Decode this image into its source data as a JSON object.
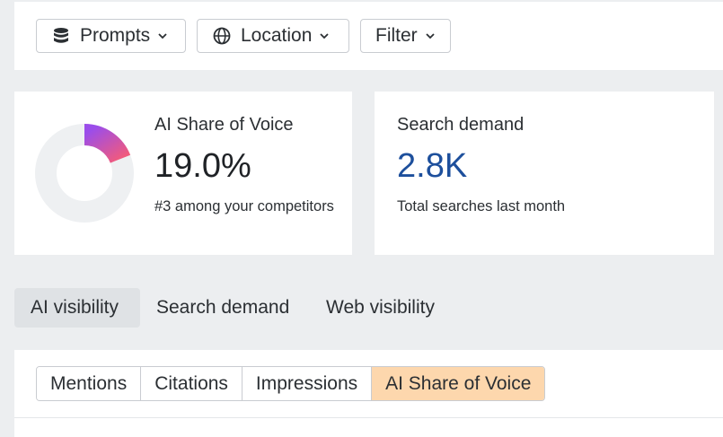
{
  "filters": {
    "prompts_label": "Prompts",
    "location_label": "Location",
    "filter_label": "Filter"
  },
  "share_of_voice": {
    "title": "AI Share of Voice",
    "value": "19.0%",
    "fraction": 0.19,
    "subtitle": "#3 among your competitors",
    "gradient_start": "#9b4dea",
    "gradient_end": "#f05a7e",
    "track_color": "#eef0f2"
  },
  "search_demand": {
    "title": "Search demand",
    "value": "2.8K",
    "subtitle": "Total searches last month",
    "value_color": "#1d4f9c"
  },
  "tabs": [
    {
      "label": "AI visibility",
      "active": true
    },
    {
      "label": "Search demand",
      "active": false
    },
    {
      "label": "Web visibility",
      "active": false
    }
  ],
  "segments": [
    {
      "label": "Mentions",
      "active": false
    },
    {
      "label": "Citations",
      "active": false
    },
    {
      "label": "Impressions",
      "active": false
    },
    {
      "label": "AI Share of Voice",
      "active": true
    }
  ],
  "icons": {
    "prompts": "database-icon",
    "location": "globe-icon",
    "dropdown": "chevron-down-icon"
  }
}
